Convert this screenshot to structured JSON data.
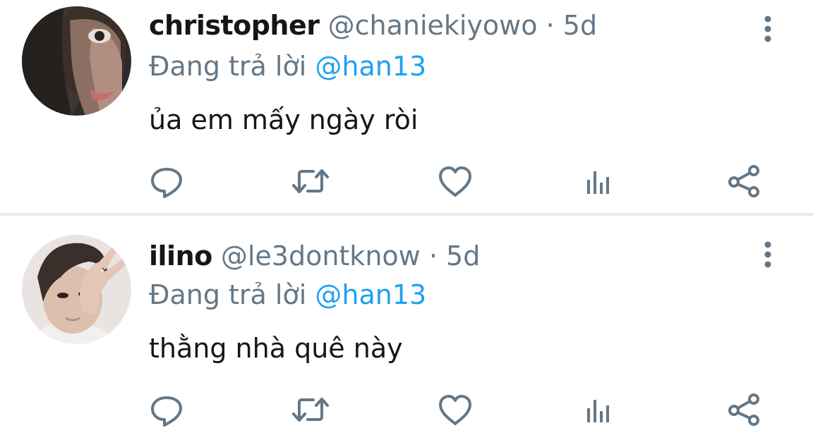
{
  "colors": {
    "text_primary": "#14171a",
    "text_secondary": "#657786",
    "mention": "#1da1f2",
    "divider": "#e6ebee",
    "icon": "#657786"
  },
  "tweets": [
    {
      "display_name": "christopher",
      "handle": "@chaniekiyowo",
      "separator": "·",
      "time": "5d",
      "reply_prefix": "Đang trả lời",
      "reply_to": "@han13",
      "text": "ủa em mấy ngày ròi",
      "avatar_icon": "user-avatar-dark-photo"
    },
    {
      "display_name": "ilino",
      "handle": "@le3dontknow",
      "separator": "·",
      "time": "5d",
      "reply_prefix": "Đang trả lời",
      "reply_to": "@han13",
      "text": "thằng nhà quê này",
      "avatar_icon": "user-avatar-peace-sign-photo"
    }
  ],
  "action_icons": [
    "reply-icon",
    "retweet-icon",
    "like-icon",
    "analytics-icon",
    "share-icon"
  ],
  "menu_icon": "more-vertical-icon"
}
